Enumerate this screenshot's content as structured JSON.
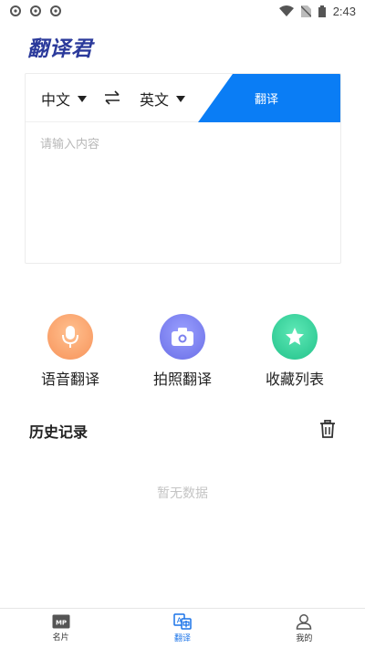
{
  "status_bar": {
    "time": "2:43"
  },
  "app": {
    "logo": "翻译君"
  },
  "translate_card": {
    "source_lang": "中文",
    "target_lang": "英文",
    "translate_button": "翻译",
    "input": {
      "value": "",
      "placeholder": "请输入内容"
    }
  },
  "features": [
    {
      "label": "语音翻译",
      "icon": "microphone-icon",
      "color": "#f7a15e"
    },
    {
      "label": "拍照翻译",
      "icon": "camera-icon",
      "color": "#6f76e8"
    },
    {
      "label": "收藏列表",
      "icon": "star-icon",
      "color": "#2fcf96"
    }
  ],
  "history": {
    "title": "历史记录",
    "empty_text": "暂无数据"
  },
  "bottom_nav": {
    "items": [
      {
        "label": "名片",
        "icon": "card-icon"
      },
      {
        "label": "翻译",
        "icon": "translate-icon"
      },
      {
        "label": "我的",
        "icon": "profile-icon"
      }
    ],
    "active_index": 1
  },
  "colors": {
    "accent": "#0a7df5",
    "brand": "#2b3a9b"
  }
}
